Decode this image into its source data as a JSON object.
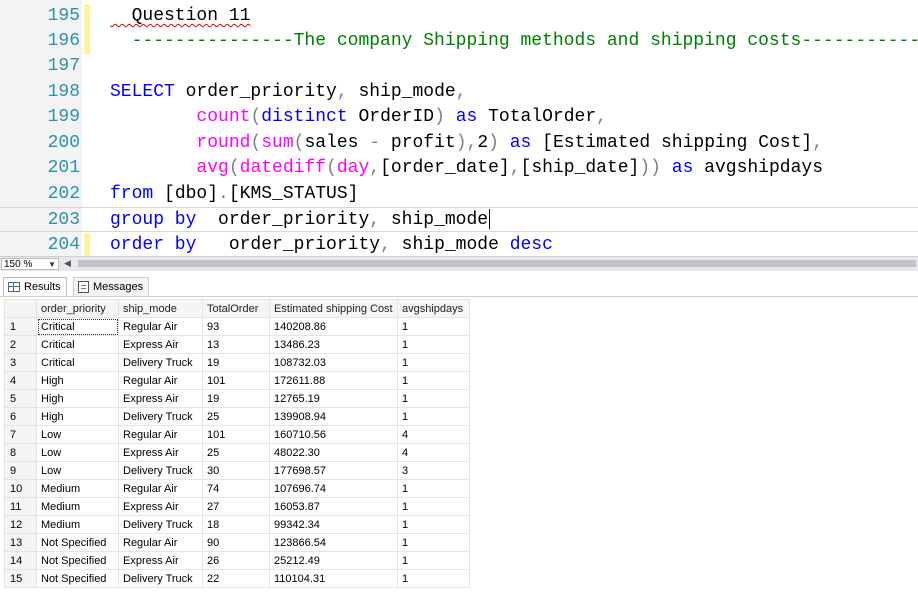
{
  "editor": {
    "lines": [
      {
        "num": "195",
        "tokens": [
          {
            "t": "  Question 11",
            "c": "tx squiggle"
          }
        ]
      },
      {
        "num": "196",
        "tokens": [
          {
            "t": "  ---------------The company Shipping methods and shipping costs-----------",
            "c": "cm"
          }
        ]
      },
      {
        "num": "197",
        "tokens": []
      },
      {
        "num": "198",
        "tokens": [
          {
            "t": "SELECT",
            "c": "kw"
          },
          {
            "t": " order_priority",
            "c": "tx"
          },
          {
            "t": ",",
            "c": "gr"
          },
          {
            "t": " ship_mode",
            "c": "tx"
          },
          {
            "t": ",",
            "c": "gr"
          }
        ]
      },
      {
        "num": "199",
        "tokens": [
          {
            "t": "        ",
            "c": "tx"
          },
          {
            "t": "count",
            "c": "fn"
          },
          {
            "t": "(",
            "c": "gr"
          },
          {
            "t": "distinct",
            "c": "kw"
          },
          {
            "t": " OrderID",
            "c": "tx"
          },
          {
            "t": ")",
            "c": "gr"
          },
          {
            "t": " as",
            "c": "kw"
          },
          {
            "t": " TotalOrder",
            "c": "tx"
          },
          {
            "t": ",",
            "c": "gr"
          }
        ]
      },
      {
        "num": "200",
        "tokens": [
          {
            "t": "        ",
            "c": "tx"
          },
          {
            "t": "round",
            "c": "fn"
          },
          {
            "t": "(",
            "c": "gr"
          },
          {
            "t": "sum",
            "c": "fn"
          },
          {
            "t": "(",
            "c": "gr"
          },
          {
            "t": "sales ",
            "c": "tx"
          },
          {
            "t": "-",
            "c": "gr"
          },
          {
            "t": " profit",
            "c": "tx"
          },
          {
            "t": "),",
            "c": "gr"
          },
          {
            "t": "2",
            "c": "tx"
          },
          {
            "t": ")",
            "c": "gr"
          },
          {
            "t": " as",
            "c": "kw"
          },
          {
            "t": " [Estimated shipping Cost]",
            "c": "tx"
          },
          {
            "t": ",",
            "c": "gr"
          }
        ]
      },
      {
        "num": "201",
        "tokens": [
          {
            "t": "        ",
            "c": "tx"
          },
          {
            "t": "avg",
            "c": "fn"
          },
          {
            "t": "(",
            "c": "gr"
          },
          {
            "t": "datediff",
            "c": "fn"
          },
          {
            "t": "(",
            "c": "gr"
          },
          {
            "t": "day",
            "c": "fn"
          },
          {
            "t": ",",
            "c": "gr"
          },
          {
            "t": "[order_date]",
            "c": "tx"
          },
          {
            "t": ",",
            "c": "gr"
          },
          {
            "t": "[ship_date]",
            "c": "tx"
          },
          {
            "t": "))",
            "c": "gr"
          },
          {
            "t": " as",
            "c": "kw"
          },
          {
            "t": " avgshipdays",
            "c": "tx"
          }
        ]
      },
      {
        "num": "202",
        "tokens": [
          {
            "t": "from",
            "c": "kw"
          },
          {
            "t": " [dbo]",
            "c": "tx"
          },
          {
            "t": ".",
            "c": "gr"
          },
          {
            "t": "[KMS_STATUS]",
            "c": "tx"
          }
        ]
      },
      {
        "num": "203",
        "tokens": [
          {
            "t": "group by",
            "c": "kw"
          },
          {
            "t": "  order_priority",
            "c": "tx"
          },
          {
            "t": ",",
            "c": "gr"
          },
          {
            "t": " ship_mode",
            "c": "tx"
          }
        ],
        "current": true
      },
      {
        "num": "204",
        "tokens": [
          {
            "t": "order by",
            "c": "kw"
          },
          {
            "t": "   order_priority",
            "c": "tx"
          },
          {
            "t": ",",
            "c": "gr"
          },
          {
            "t": " ship_mode",
            "c": "tx"
          },
          {
            "t": " desc",
            "c": "kw"
          }
        ]
      }
    ]
  },
  "zoom": {
    "value": "150 %"
  },
  "tabs": {
    "results": "Results",
    "messages": "Messages"
  },
  "grid": {
    "columns": [
      "order_priority",
      "ship_mode",
      "TotalOrder",
      "Estimated shipping Cost",
      "avgshipdays"
    ],
    "rows": [
      [
        "1",
        "Critical",
        "Regular Air",
        "93",
        "140208.86",
        "1"
      ],
      [
        "2",
        "Critical",
        "Express Air",
        "13",
        "13486.23",
        "1"
      ],
      [
        "3",
        "Critical",
        "Delivery Truck",
        "19",
        "108732.03",
        "1"
      ],
      [
        "4",
        "High",
        "Regular Air",
        "101",
        "172611.88",
        "1"
      ],
      [
        "5",
        "High",
        "Express Air",
        "19",
        "12765.19",
        "1"
      ],
      [
        "6",
        "High",
        "Delivery Truck",
        "25",
        "139908.94",
        "1"
      ],
      [
        "7",
        "Low",
        "Regular Air",
        "101",
        "160710.56",
        "4"
      ],
      [
        "8",
        "Low",
        "Express Air",
        "25",
        "48022.30",
        "4"
      ],
      [
        "9",
        "Low",
        "Delivery Truck",
        "30",
        "177698.57",
        "3"
      ],
      [
        "10",
        "Medium",
        "Regular Air",
        "74",
        "107696.74",
        "1"
      ],
      [
        "11",
        "Medium",
        "Express Air",
        "27",
        "16053.87",
        "1"
      ],
      [
        "12",
        "Medium",
        "Delivery Truck",
        "18",
        "99342.34",
        "1"
      ],
      [
        "13",
        "Not Specified",
        "Regular Air",
        "90",
        "123866.54",
        "1"
      ],
      [
        "14",
        "Not Specified",
        "Express Air",
        "26",
        "25212.49",
        "1"
      ],
      [
        "15",
        "Not Specified",
        "Delivery Truck",
        "22",
        "110104.31",
        "1"
      ]
    ]
  }
}
